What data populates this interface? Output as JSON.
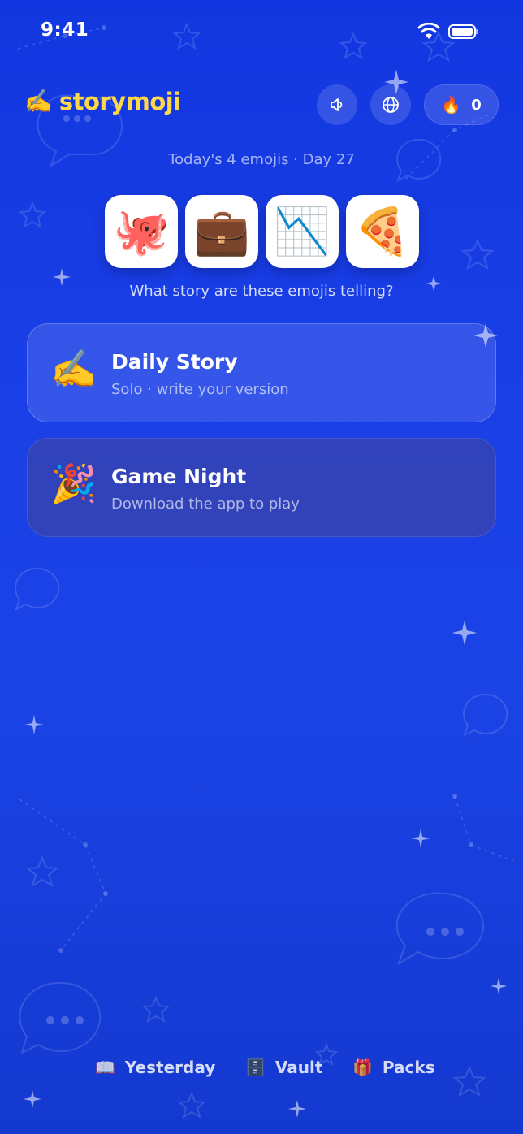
{
  "status_bar": {
    "time": "9:41"
  },
  "header": {
    "logo_emoji": "✍️",
    "app_name": "storymoji",
    "sound_icon": "speaker-icon",
    "language_icon": "globe-icon",
    "streak_icon": "🔥",
    "streak_count": "0"
  },
  "day_label": "Today's 4 emojis · Day 27",
  "emojis": [
    "🐙",
    "💼",
    "📉",
    "🍕"
  ],
  "prompt": "What story are these emojis telling?",
  "cards": [
    {
      "icon": "✍️",
      "title": "Daily Story",
      "subtitle": "Solo · write your version"
    },
    {
      "icon": "🎉",
      "title": "Game Night",
      "subtitle": "Download the app to play"
    }
  ],
  "bottom_nav": [
    {
      "icon": "📖",
      "label": "Yesterday"
    },
    {
      "icon": "🗄️",
      "label": "Vault"
    },
    {
      "icon": "🎁",
      "label": "Packs"
    }
  ],
  "colors": {
    "background": "#1a3fe6",
    "logo_text": "#ffd84a"
  }
}
